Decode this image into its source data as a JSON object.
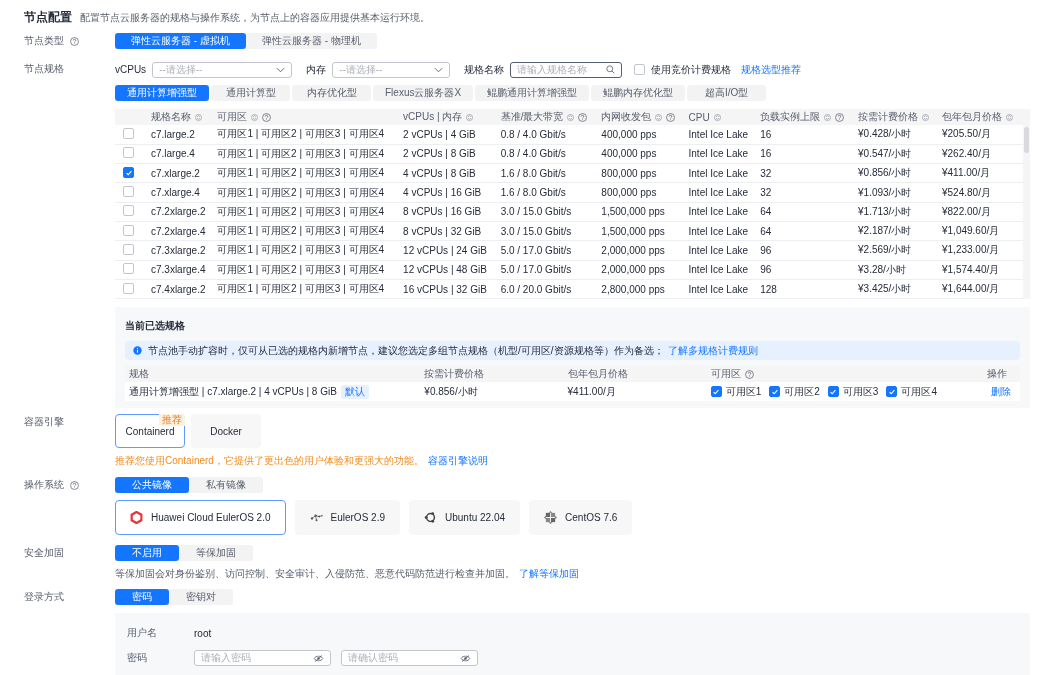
{
  "section": {
    "title": "节点配置",
    "description": "配置节点云服务器的规格与操作系统，为节点上的容器应用提供基本运行环境。"
  },
  "node_type": {
    "label": "节点类型",
    "help": true,
    "options": [
      {
        "label": "弹性云服务器 - 虚拟机",
        "selected": true
      },
      {
        "label": "弹性云服务器 - 物理机",
        "selected": false
      }
    ]
  },
  "node_spec": {
    "label": "节点规格",
    "filters": {
      "vcpus": {
        "label": "vCPUs",
        "placeholder": "--请选择--"
      },
      "memory": {
        "label": "内存",
        "placeholder": "--请选择--"
      },
      "spec_name": {
        "label": "规格名称",
        "placeholder": "请输入规格名称"
      },
      "bidding": {
        "label": "使用竞价计费规格",
        "checked": false
      },
      "link": "规格选型推荐"
    },
    "categories": [
      {
        "label": "通用计算增强型",
        "selected": true
      },
      {
        "label": "通用计算型",
        "selected": false
      },
      {
        "label": "内存优化型",
        "selected": false
      },
      {
        "label": "Flexus云服务器X",
        "selected": false
      },
      {
        "label": "鲲鹏通用计算增强型",
        "selected": false
      },
      {
        "label": "鲲鹏内存优化型",
        "selected": false
      },
      {
        "label": "超高I/O型",
        "selected": false
      }
    ],
    "table": {
      "columns": [
        {
          "label": "规格名称",
          "help": false
        },
        {
          "label": "可用区",
          "help": true
        },
        {
          "label": "vCPUs | 内存",
          "help": false
        },
        {
          "label": "基准/最大带宽",
          "help": true
        },
        {
          "label": "内网收发包",
          "help": true
        },
        {
          "label": "CPU",
          "help": false
        },
        {
          "label": "负载实例上限",
          "help": true
        },
        {
          "label": "按需计费价格",
          "help": false
        },
        {
          "label": "包年包月价格",
          "help": false
        }
      ],
      "rows": [
        {
          "selected": false,
          "cells": [
            "c7.large.2",
            "可用区1 | 可用区2 | 可用区3 | 可用区4",
            "2 vCPUs | 4 GiB",
            "0.8 / 4.0 Gbit/s",
            "400,000 pps",
            "Intel Ice Lake",
            "16",
            "¥0.428/小时",
            "¥205.50/月"
          ]
        },
        {
          "selected": false,
          "cells": [
            "c7.large.4",
            "可用区1 | 可用区2 | 可用区3 | 可用区4",
            "2 vCPUs | 8 GiB",
            "0.8 / 4.0 Gbit/s",
            "400,000 pps",
            "Intel Ice Lake",
            "16",
            "¥0.547/小时",
            "¥262.40/月"
          ]
        },
        {
          "selected": true,
          "cells": [
            "c7.xlarge.2",
            "可用区1 | 可用区2 | 可用区3 | 可用区4",
            "4 vCPUs | 8 GiB",
            "1.6 / 8.0 Gbit/s",
            "800,000 pps",
            "Intel Ice Lake",
            "32",
            "¥0.856/小时",
            "¥411.00/月"
          ]
        },
        {
          "selected": false,
          "cells": [
            "c7.xlarge.4",
            "可用区1 | 可用区2 | 可用区3 | 可用区4",
            "4 vCPUs | 16 GiB",
            "1.6 / 8.0 Gbit/s",
            "800,000 pps",
            "Intel Ice Lake",
            "32",
            "¥1.093/小时",
            "¥524.80/月"
          ]
        },
        {
          "selected": false,
          "cells": [
            "c7.2xlarge.2",
            "可用区1 | 可用区2 | 可用区3 | 可用区4",
            "8 vCPUs | 16 GiB",
            "3.0 / 15.0 Gbit/s",
            "1,500,000 pps",
            "Intel Ice Lake",
            "64",
            "¥1.713/小时",
            "¥822.00/月"
          ]
        },
        {
          "selected": false,
          "cells": [
            "c7.2xlarge.4",
            "可用区1 | 可用区2 | 可用区3 | 可用区4",
            "8 vCPUs | 32 GiB",
            "3.0 / 15.0 Gbit/s",
            "1,500,000 pps",
            "Intel Ice Lake",
            "64",
            "¥2.187/小时",
            "¥1,049.60/月"
          ]
        },
        {
          "selected": false,
          "cells": [
            "c7.3xlarge.2",
            "可用区1 | 可用区2 | 可用区3 | 可用区4",
            "12 vCPUs | 24 GiB",
            "5.0 / 17.0 Gbit/s",
            "2,000,000 pps",
            "Intel Ice Lake",
            "96",
            "¥2.569/小时",
            "¥1,233.00/月"
          ]
        },
        {
          "selected": false,
          "cells": [
            "c7.3xlarge.4",
            "可用区1 | 可用区2 | 可用区3 | 可用区4",
            "12 vCPUs | 48 GiB",
            "5.0 / 17.0 Gbit/s",
            "2,000,000 pps",
            "Intel Ice Lake",
            "96",
            "¥3.28/小时",
            "¥1,574.40/月"
          ]
        },
        {
          "selected": false,
          "cells": [
            "c7.4xlarge.2",
            "可用区1 | 可用区2 | 可用区3 | 可用区4",
            "16 vCPUs | 32 GiB",
            "6.0 / 20.0 Gbit/s",
            "2,800,000 pps",
            "Intel Ice Lake",
            "128",
            "¥3.425/小时",
            "¥1,644.00/月"
          ]
        }
      ]
    }
  },
  "selected_specs": {
    "title": "当前已选规格",
    "notice": {
      "text": "节点池手动扩容时，仅可从已选的规格内新增节点，建议您选定多组节点规格（机型/可用区/资源规格等）作为备选；",
      "link": "了解多规格计费规则"
    },
    "columns": [
      {
        "label": "规格",
        "help": false
      },
      {
        "label": "按需计费价格",
        "help": false
      },
      {
        "label": "包年包月价格",
        "help": false
      },
      {
        "label": "可用区",
        "help": true
      },
      {
        "label": "操作",
        "help": false
      }
    ],
    "rows": [
      {
        "spec": "通用计算增强型 | c7.xlarge.2 | 4 vCPUs | 8 GiB",
        "tag": "默认",
        "on_demand": "¥0.856/小时",
        "monthly": "¥411.00/月",
        "zones": [
          {
            "label": "可用区1",
            "checked": true
          },
          {
            "label": "可用区2",
            "checked": true
          },
          {
            "label": "可用区3",
            "checked": true
          },
          {
            "label": "可用区4",
            "checked": true
          }
        ],
        "action": "删除"
      }
    ]
  },
  "container_engine": {
    "label": "容器引擎",
    "options": [
      {
        "label": "Containerd",
        "selected": true,
        "badge": "推荐"
      },
      {
        "label": "Docker",
        "selected": false
      }
    ],
    "hint": "推荐您使用Containerd，它提供了更出色的用户体验和更强大的功能。",
    "link": "容器引擎说明"
  },
  "os": {
    "label": "操作系统",
    "help": true,
    "tabs": [
      {
        "label": "公共镜像",
        "selected": true
      },
      {
        "label": "私有镜像",
        "selected": false
      }
    ],
    "images": [
      {
        "label": "Huawei Cloud EulerOS 2.0",
        "kind": "hce",
        "selected": true
      },
      {
        "label": "EulerOS 2.9",
        "kind": "euler",
        "selected": false
      },
      {
        "label": "Ubuntu 22.04",
        "kind": "ubuntu",
        "selected": false
      },
      {
        "label": "CentOS 7.6",
        "kind": "centos",
        "selected": false
      }
    ]
  },
  "security": {
    "label": "安全加固",
    "options": [
      {
        "label": "不启用",
        "selected": true
      },
      {
        "label": "等保加固",
        "selected": false
      }
    ],
    "hint": "等保加固会对身份鉴别、访问控制、安全审计、入侵防范、恶意代码防范进行检查并加固。",
    "link": "了解等保加固"
  },
  "login": {
    "label": "登录方式",
    "options": [
      {
        "label": "密码",
        "selected": true
      },
      {
        "label": "密钥对",
        "selected": false
      }
    ],
    "username_label": "用户名",
    "username": "root",
    "password_label": "密码",
    "password_placeholder": "请输入密码",
    "confirm_placeholder": "请确认密码"
  }
}
